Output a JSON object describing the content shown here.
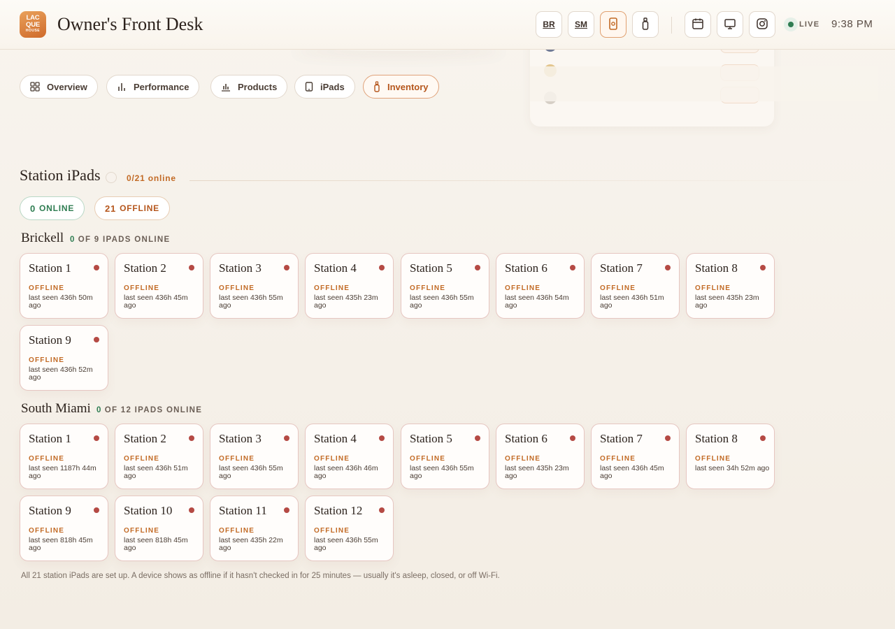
{
  "app": {
    "logo_top": "LAC",
    "logo_mid": "QUE",
    "logo_bottom": "HOUSE",
    "title": "Owner's Front Desk"
  },
  "header": {
    "loc_br": "BR",
    "loc_sm": "SM",
    "icons": [
      "ipad-icon",
      "bottle-icon",
      "calendar-icon",
      "monitor-icon",
      "instagram-icon"
    ],
    "live_label": "LIVE",
    "time": "9:38 PM"
  },
  "tabs": [
    {
      "label": "Overview",
      "icon": "grid-icon"
    },
    {
      "label": "Performance",
      "icon": "bar-chart-icon"
    },
    {
      "label": "Products",
      "icon": "column-chart-icon"
    },
    {
      "label": "iPads",
      "icon": "tablet-icon"
    },
    {
      "label": "Inventory",
      "icon": "bottle-icon",
      "active": true
    }
  ],
  "section": {
    "title": "Station iPads",
    "count": "0/21 online",
    "filter_online_num": "0",
    "filter_online_label": "ONLINE",
    "filter_offline_num": "21",
    "filter_offline_label": "OFFLINE"
  },
  "locations": {
    "brickell": {
      "name": "Brickell",
      "online_num": "0",
      "online_text": "OF 9 IPADS ONLINE",
      "stations": [
        {
          "name": "Station 1",
          "status": "OFFLINE",
          "seen": "last seen 436h 50m ago"
        },
        {
          "name": "Station 2",
          "status": "OFFLINE",
          "seen": "last seen 436h 45m ago"
        },
        {
          "name": "Station 3",
          "status": "OFFLINE",
          "seen": "last seen 436h 55m ago"
        },
        {
          "name": "Station 4",
          "status": "OFFLINE",
          "seen": "last seen 435h 23m ago"
        },
        {
          "name": "Station 5",
          "status": "OFFLINE",
          "seen": "last seen 436h 55m ago"
        },
        {
          "name": "Station 6",
          "status": "OFFLINE",
          "seen": "last seen 436h 54m ago"
        },
        {
          "name": "Station 7",
          "status": "OFFLINE",
          "seen": "last seen 436h 51m ago"
        },
        {
          "name": "Station 8",
          "status": "OFFLINE",
          "seen": "last seen 435h 23m ago"
        },
        {
          "name": "Station 9",
          "status": "OFFLINE",
          "seen": "last seen 436h 52m ago"
        }
      ]
    },
    "south_miami": {
      "name": "South Miami",
      "online_num": "0",
      "online_text": "OF 12 IPADS ONLINE",
      "stations": [
        {
          "name": "Station 1",
          "status": "OFFLINE",
          "seen": "last seen 1187h 44m ago"
        },
        {
          "name": "Station 2",
          "status": "OFFLINE",
          "seen": "last seen 436h 51m ago"
        },
        {
          "name": "Station 3",
          "status": "OFFLINE",
          "seen": "last seen 436h 55m ago"
        },
        {
          "name": "Station 4",
          "status": "OFFLINE",
          "seen": "last seen 436h 46m ago"
        },
        {
          "name": "Station 5",
          "status": "OFFLINE",
          "seen": "last seen 436h 55m ago"
        },
        {
          "name": "Station 6",
          "status": "OFFLINE",
          "seen": "last seen 435h 23m ago"
        },
        {
          "name": "Station 7",
          "status": "OFFLINE",
          "seen": "last seen 436h 45m ago"
        },
        {
          "name": "Station 8",
          "status": "OFFLINE",
          "seen": "last seen 34h 52m ago"
        },
        {
          "name": "Station 9",
          "status": "OFFLINE",
          "seen": "last seen 818h 45m ago"
        },
        {
          "name": "Station 10",
          "status": "OFFLINE",
          "seen": "last seen 818h 45m ago"
        },
        {
          "name": "Station 11",
          "status": "OFFLINE",
          "seen": "last seen 435h 22m ago"
        },
        {
          "name": "Station 12",
          "status": "OFFLINE",
          "seen": "last seen 436h 55m ago"
        }
      ]
    }
  },
  "footnote": "All 21 station iPads are set up. A device shows as offline if it hasn't checked in for 25 minutes — usually it's asleep, closed, or off Wi-Fi.",
  "colors": {
    "accent": "#c26a25",
    "online": "#2f7d52",
    "offline_dot": "#b54a44",
    "background": "#f5efe7"
  }
}
